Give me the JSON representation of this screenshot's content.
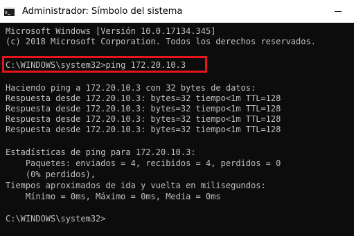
{
  "window": {
    "title": "Administrador: Símbolo del sistema",
    "app_icon": "cmd-icon"
  },
  "console": {
    "lines": [
      "Microsoft Windows [Versión 10.0.17134.345]",
      "(c) 2018 Microsoft Corporation. Todos los derechos reservados.",
      "",
      "C:\\WINDOWS\\system32>ping 172.20.10.3",
      "",
      "Haciendo ping a 172.20.10.3 con 32 bytes de datos:",
      "Respuesta desde 172.20.10.3: bytes=32 tiempo<1m TTL=128",
      "Respuesta desde 172.20.10.3: bytes=32 tiempo<1m TTL=128",
      "Respuesta desde 172.20.10.3: bytes=32 tiempo<1m TTL=128",
      "Respuesta desde 172.20.10.3: bytes=32 tiempo<1m TTL=128",
      "",
      "Estadísticas de ping para 172.20.10.3:",
      "    Paquetes: enviados = 4, recibidos = 4, perdidos = 0",
      "    (0% perdidos),",
      "Tiempos aproximados de ida y vuelta en milisegundos:",
      "    Mínimo = 0ms, Máximo = 0ms, Media = 0ms",
      "",
      "C:\\WINDOWS\\system32>"
    ],
    "highlight_color": "#e8141c"
  }
}
